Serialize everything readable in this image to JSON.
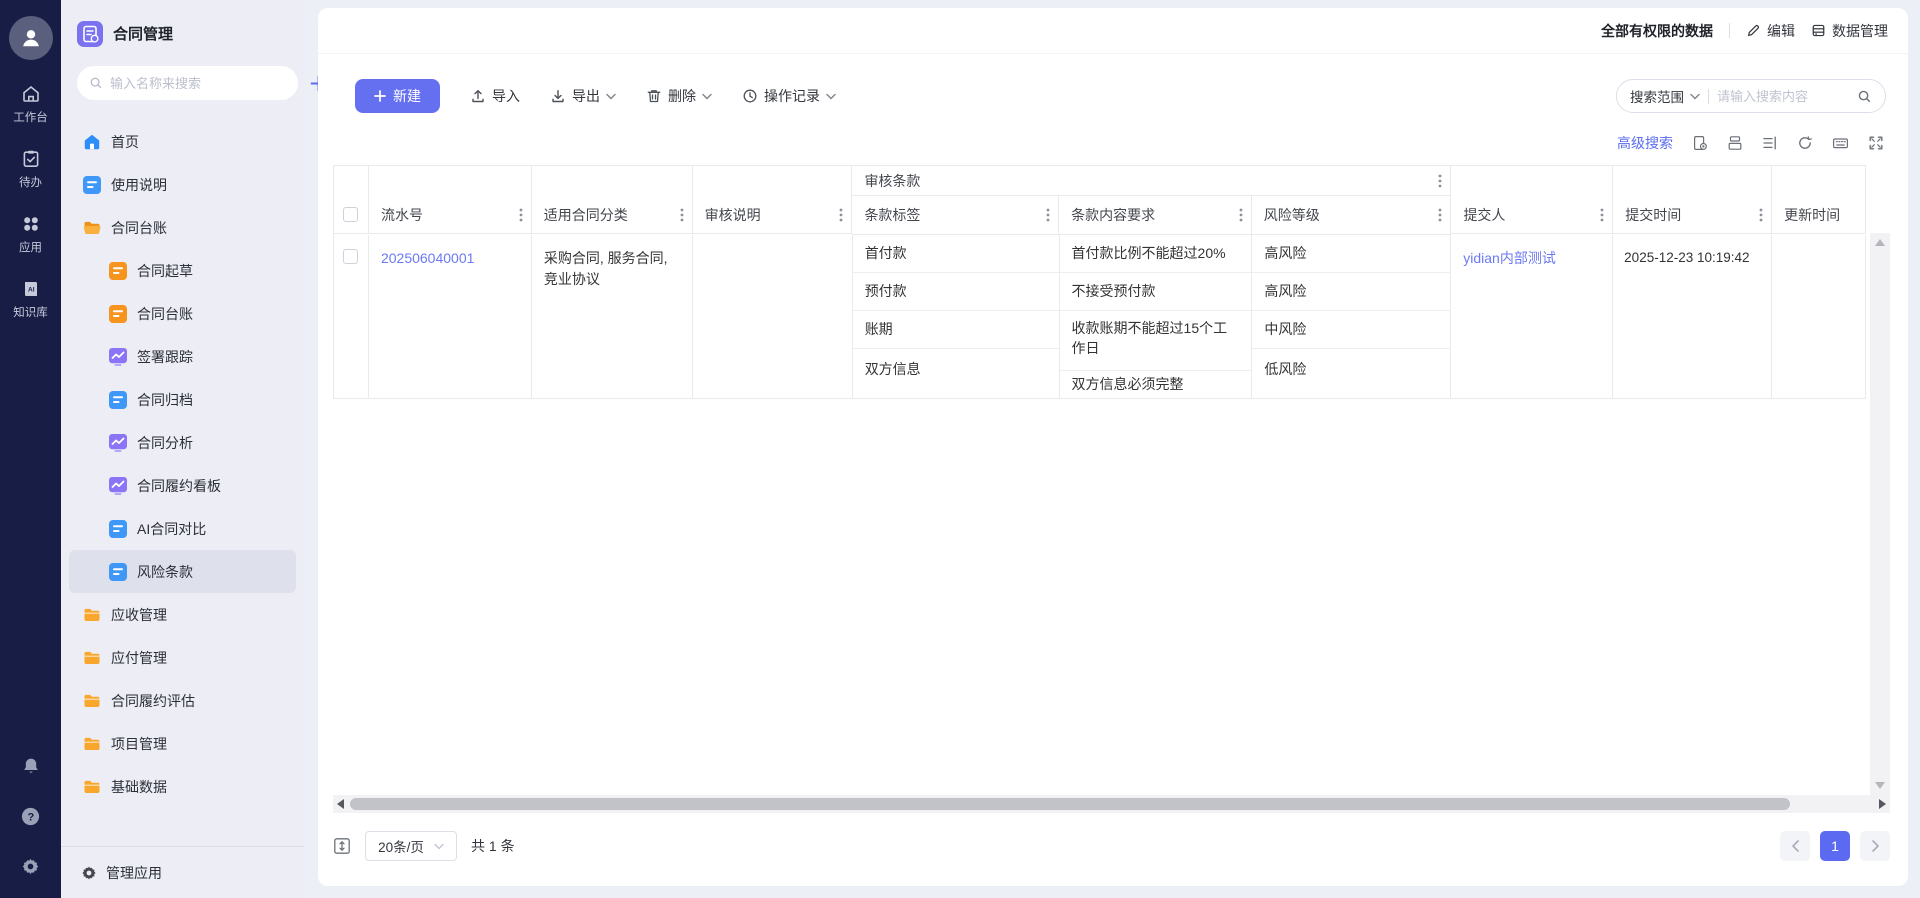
{
  "rail": {
    "items": [
      {
        "label": "工作台"
      },
      {
        "label": "待办"
      },
      {
        "label": "应用"
      },
      {
        "label": "知识库"
      }
    ]
  },
  "sidebar": {
    "app_title": "合同管理",
    "search_placeholder": "输入名称来搜索",
    "menu": [
      {
        "label": "首页"
      },
      {
        "label": "使用说明"
      },
      {
        "label": "合同台账"
      },
      {
        "label": "合同起草"
      },
      {
        "label": "合同台账"
      },
      {
        "label": "签署跟踪"
      },
      {
        "label": "合同归档"
      },
      {
        "label": "合同分析"
      },
      {
        "label": "合同履约看板"
      },
      {
        "label": "AI合同对比"
      },
      {
        "label": "风险条款"
      },
      {
        "label": "应收管理"
      },
      {
        "label": "应付管理"
      },
      {
        "label": "合同履约评估"
      },
      {
        "label": "项目管理"
      },
      {
        "label": "基础数据"
      }
    ],
    "footer_label": "管理应用"
  },
  "topbar": {
    "scope_label": "全部有权限的数据",
    "edit_label": "编辑",
    "data_manage_label": "数据管理"
  },
  "toolbar": {
    "new_label": "新建",
    "import_label": "导入",
    "export_label": "导出",
    "delete_label": "删除",
    "ops_label": "操作记录",
    "search_scope_label": "搜索范围",
    "search_placeholder": "请输入搜索内容"
  },
  "controls": {
    "advanced_search_label": "高级搜索"
  },
  "table": {
    "group_header": "审核条款",
    "col_serial": "流水号",
    "col_category": "适用合同分类",
    "col_note": "审核说明",
    "col_tag": "条款标签",
    "col_req": "条款内容要求",
    "col_risk": "风险等级",
    "col_submitter": "提交人",
    "col_time": "提交时间",
    "col_update": "更新时间",
    "row": {
      "serial": "202506040001",
      "category": "采购合同, 服务合同, 竞业协议",
      "note": "",
      "clauses": [
        {
          "tag": "首付款",
          "req": "首付款比例不能超过20%",
          "risk": "高风险"
        },
        {
          "tag": "预付款",
          "req": "不接受预付款",
          "risk": "高风险"
        },
        {
          "tag": "账期",
          "req": "收款账期不能超过15个工作日",
          "risk": "中风险"
        },
        {
          "tag": "双方信息",
          "req": "双方信息必须完整",
          "risk": "低风险"
        }
      ],
      "submitter": "yidian内部测试",
      "submit_time": "2025-12-23 10:19:42",
      "update_time": ""
    }
  },
  "pagination": {
    "page_size": "20条/页",
    "total_label": "共 1 条",
    "current_page": "1"
  },
  "colors": {
    "accent": "#5b6af0",
    "link": "#6b79f3",
    "rail_bg": "#181d45",
    "sidebar_bg": "#ecedf5"
  }
}
